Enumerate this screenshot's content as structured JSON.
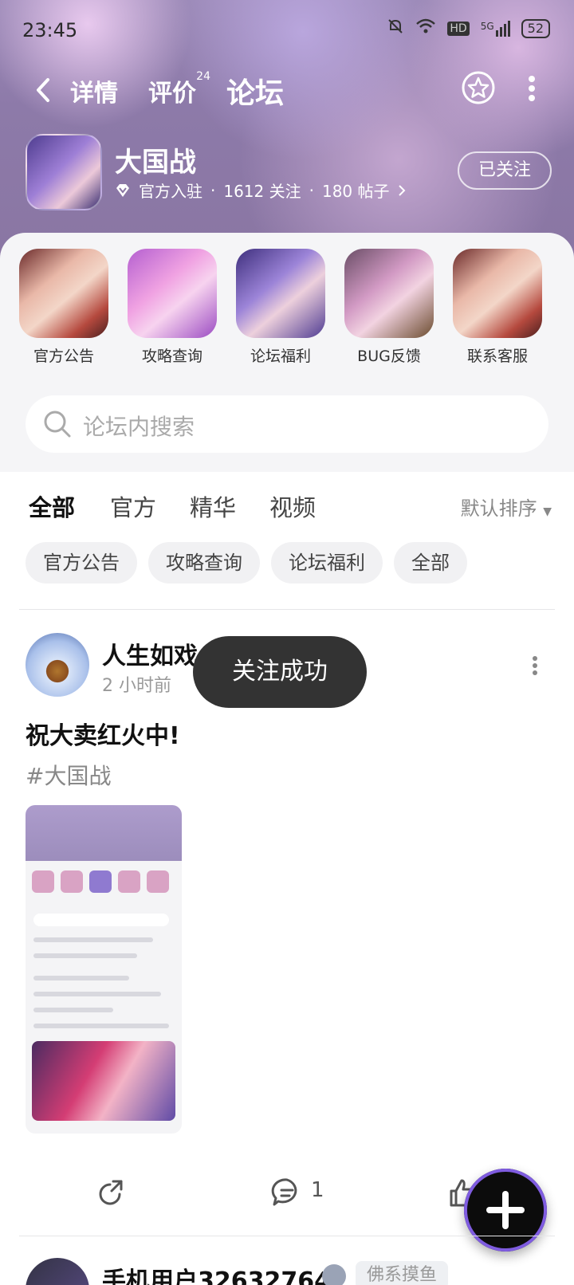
{
  "status_bar": {
    "time": "23:45",
    "network": "5G",
    "hd": "HD",
    "battery": "52"
  },
  "nav": {
    "tabs": [
      {
        "label": "详情"
      },
      {
        "label": "评价",
        "badge": "24"
      },
      {
        "label": "论坛"
      }
    ],
    "active_tab": "论坛",
    "accent_color": "#1ed4c4"
  },
  "game": {
    "name": "大国战",
    "official": "官方入驻",
    "followers": "1612 关注",
    "posts": "180 帖子",
    "separator": "·",
    "follow_label": "已关注"
  },
  "shortcuts": [
    {
      "label": "官方公告"
    },
    {
      "label": "攻略查询"
    },
    {
      "label": "论坛福利"
    },
    {
      "label": "BUG反馈"
    },
    {
      "label": "联系客服"
    }
  ],
  "search": {
    "placeholder": "论坛内搜索"
  },
  "filter_tabs": [
    {
      "label": "全部"
    },
    {
      "label": "官方"
    },
    {
      "label": "精华"
    },
    {
      "label": "视频"
    }
  ],
  "sort_label": "默认排序",
  "chips": [
    {
      "label": "官方公告"
    },
    {
      "label": "攻略查询"
    },
    {
      "label": "论坛福利"
    },
    {
      "label": "全部"
    }
  ],
  "post": {
    "author": "人生如戏",
    "time": "2 小时前",
    "title": "祝大卖红火中!",
    "tag": "#大国战",
    "comment_count": "1"
  },
  "next_post": {
    "author": "手机用户32632764",
    "badge": "佛系摸鱼"
  },
  "toast": "关注成功"
}
